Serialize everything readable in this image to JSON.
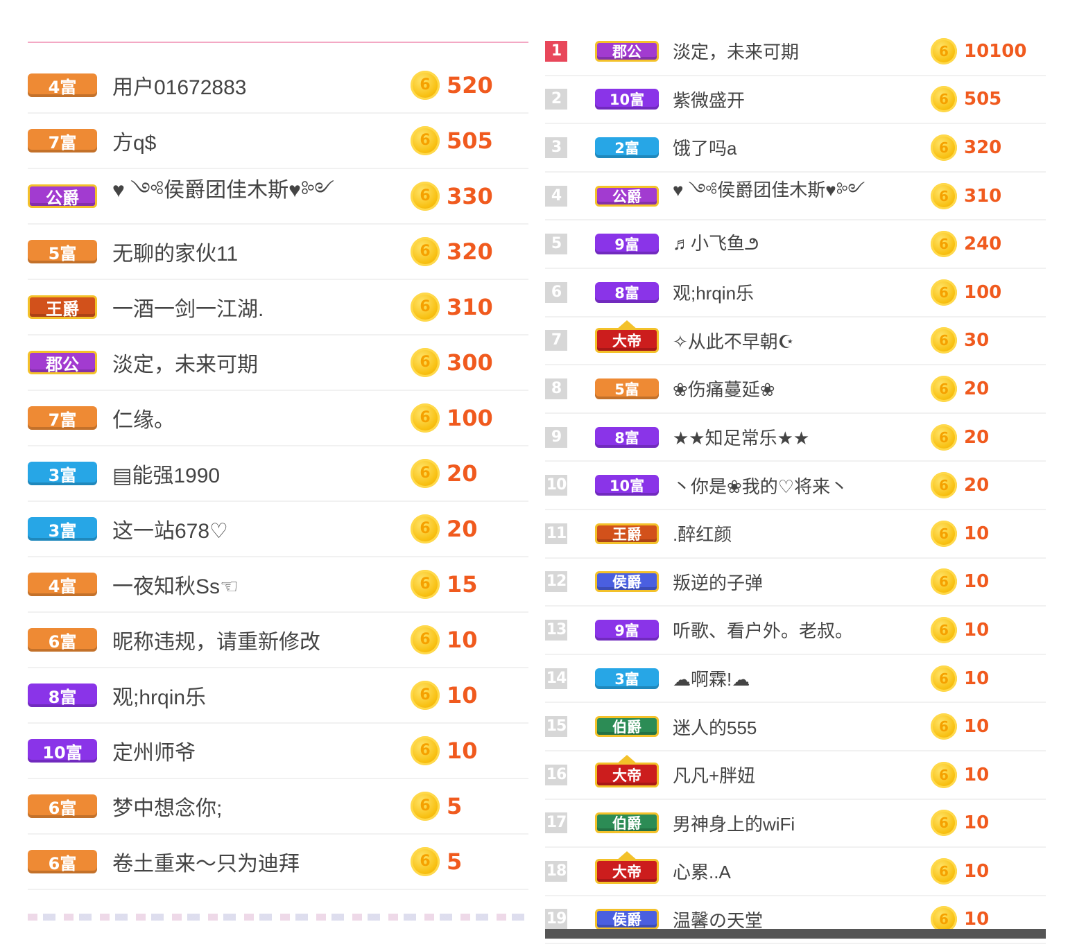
{
  "left_list": [
    {
      "badge": "4富",
      "badge_style": "orange",
      "name": "用户01672883",
      "coin": "6",
      "amount": "520"
    },
    {
      "badge": "7富",
      "badge_style": "orange",
      "name": "方q$",
      "coin": "6",
      "amount": "505"
    },
    {
      "badge": "公爵",
      "badge_style": "duke",
      "name": "♥ ༺侯爵团佳木斯♥༻",
      "coin": "6",
      "amount": "330"
    },
    {
      "badge": "5富",
      "badge_style": "orange",
      "name": "无聊的家伙11",
      "coin": "6",
      "amount": "320"
    },
    {
      "badge": "王爵",
      "badge_style": "king",
      "name": "一酒一剑一江湖.",
      "coin": "6",
      "amount": "310"
    },
    {
      "badge": "郡公",
      "badge_style": "magenta",
      "name": "淡定，未来可期",
      "coin": "6",
      "amount": "300"
    },
    {
      "badge": "7富",
      "badge_style": "orange",
      "name": "仁缘。",
      "coin": "6",
      "amount": "100"
    },
    {
      "badge": "3富",
      "badge_style": "blue",
      "name": "▤能强1990",
      "coin": "6",
      "amount": "20"
    },
    {
      "badge": "3富",
      "badge_style": "blue",
      "name": "这一站678♡",
      "coin": "6",
      "amount": "20"
    },
    {
      "badge": "4富",
      "badge_style": "orange",
      "name": "一夜知秋Ss☜",
      "coin": "6",
      "amount": "15"
    },
    {
      "badge": "6富",
      "badge_style": "orange",
      "name": "昵称违规，请重新修改",
      "coin": "6",
      "amount": "10"
    },
    {
      "badge": "8富",
      "badge_style": "purple",
      "name": "观;hrqin乐",
      "coin": "6",
      "amount": "10"
    },
    {
      "badge": "10富",
      "badge_style": "purple",
      "name": "定州师爷",
      "coin": "6",
      "amount": "10"
    },
    {
      "badge": "6富",
      "badge_style": "orange",
      "name": "梦中想念你;",
      "coin": "6",
      "amount": "5"
    },
    {
      "badge": "6富",
      "badge_style": "orange",
      "name": "卷土重来～只为迪拜",
      "coin": "6",
      "amount": "5"
    }
  ],
  "right_list": [
    {
      "rank": "1",
      "badge": "郡公",
      "badge_style": "magenta",
      "name": "淡定，未来可期",
      "coin": "6",
      "amount": "10100"
    },
    {
      "rank": "2",
      "badge": "10富",
      "badge_style": "purple",
      "name": "紫微盛开",
      "coin": "6",
      "amount": "505"
    },
    {
      "rank": "3",
      "badge": "2富",
      "badge_style": "blue",
      "name": "饿了吗a",
      "coin": "6",
      "amount": "320"
    },
    {
      "rank": "4",
      "badge": "公爵",
      "badge_style": "duke",
      "name": "♥ ༺侯爵团佳木斯♥༻",
      "coin": "6",
      "amount": "310"
    },
    {
      "rank": "5",
      "badge": "9富",
      "badge_style": "purple",
      "name": "♬小飞鱼౨",
      "coin": "6",
      "amount": "240"
    },
    {
      "rank": "6",
      "badge": "8富",
      "badge_style": "purple",
      "name": "观;hrqin乐",
      "coin": "6",
      "amount": "100"
    },
    {
      "rank": "7",
      "badge": "大帝",
      "badge_style": "emperor",
      "name": "✧从此不早朝☪",
      "coin": "6",
      "amount": "30"
    },
    {
      "rank": "8",
      "badge": "5富",
      "badge_style": "orange",
      "name": "❀伤痛蔓延❀",
      "coin": "6",
      "amount": "20"
    },
    {
      "rank": "9",
      "badge": "8富",
      "badge_style": "purple",
      "name": "★★知足常乐★★",
      "coin": "6",
      "amount": "20"
    },
    {
      "rank": "10",
      "badge": "10富",
      "badge_style": "purple",
      "name": "丶你是❀我的♡将来丶",
      "coin": "6",
      "amount": "20"
    },
    {
      "rank": "11",
      "badge": "王爵",
      "badge_style": "king",
      "name": ".醉红颜",
      "coin": "6",
      "amount": "10"
    },
    {
      "rank": "12",
      "badge": "侯爵",
      "badge_style": "marquis",
      "name": "叛逆的子弹",
      "coin": "6",
      "amount": "10"
    },
    {
      "rank": "13",
      "badge": "9富",
      "badge_style": "purple",
      "name": "听歌、看户外。老叔。",
      "coin": "6",
      "amount": "10"
    },
    {
      "rank": "14",
      "badge": "3富",
      "badge_style": "blue",
      "name": "☁啊霖!☁",
      "coin": "6",
      "amount": "10"
    },
    {
      "rank": "15",
      "badge": "伯爵",
      "badge_style": "earl",
      "name": "迷人的555",
      "coin": "6",
      "amount": "10"
    },
    {
      "rank": "16",
      "badge": "大帝",
      "badge_style": "emperor",
      "name": "凡凡+胖妞",
      "coin": "6",
      "amount": "10"
    },
    {
      "rank": "17",
      "badge": "伯爵",
      "badge_style": "earl",
      "name": "男神身上的wiFi",
      "coin": "6",
      "amount": "10"
    },
    {
      "rank": "18",
      "badge": "大帝",
      "badge_style": "emperor",
      "name": "心累..A",
      "coin": "6",
      "amount": "10"
    },
    {
      "rank": "19",
      "badge": "侯爵",
      "badge_style": "marquis",
      "name": "温馨の天堂",
      "coin": "6",
      "amount": "10"
    }
  ]
}
